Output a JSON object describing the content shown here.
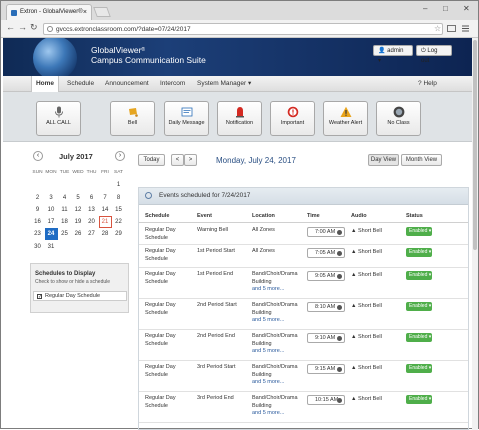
{
  "browser": {
    "tab_title": "Extron - GlobalViewer®",
    "url": "gvccs.extronclassroom.com/?date=07/24/2017"
  },
  "header": {
    "brand_line1": "GlobalViewer",
    "brand_reg": "®",
    "brand_line2": "Campus Communication Suite",
    "user_label": "admin",
    "logout_label": "Log out"
  },
  "menu": {
    "items": [
      "Home",
      "Schedule",
      "Announcement",
      "Intercom",
      "System Manager"
    ],
    "help": "Help"
  },
  "toolbar": {
    "buttons": [
      {
        "label": "ALL CALL",
        "icon": "microphone-icon"
      },
      {
        "label": "Bell",
        "icon": "bell-icon"
      },
      {
        "label": "Daily Message",
        "icon": "daily-message-icon"
      },
      {
        "label": "Notification",
        "icon": "siren-icon"
      },
      {
        "label": "Important",
        "icon": "alert-circle-icon"
      },
      {
        "label": "Weather Alert",
        "icon": "warning-triangle-icon"
      },
      {
        "label": "No Class",
        "icon": "no-class-icon"
      }
    ]
  },
  "calendar": {
    "title": "July 2017",
    "weekdays": [
      "SUN",
      "MON",
      "TUE",
      "WED",
      "THU",
      "FRI",
      "SAT"
    ],
    "weeks": [
      [
        "",
        "",
        "",
        "",
        "",
        "",
        "1"
      ],
      [
        "2",
        "3",
        "4",
        "5",
        "6",
        "7",
        "8"
      ],
      [
        "9",
        "10",
        "11",
        "12",
        "13",
        "14",
        "15"
      ],
      [
        "16",
        "17",
        "18",
        "19",
        "20",
        "21",
        "22"
      ],
      [
        "23",
        "24",
        "25",
        "26",
        "27",
        "28",
        "29"
      ],
      [
        "30",
        "31",
        "",
        "",
        "",
        "",
        ""
      ]
    ],
    "today": "24",
    "marked": "21"
  },
  "schedules": {
    "title": "Schedules to Display",
    "subtitle": "Check to show or hide a schedule",
    "item": "Regular Day Schedule"
  },
  "datebar": {
    "today": "Today",
    "prev": "<",
    "next": ">",
    "title": "Monday, July 24, 2017",
    "day_view": "Day View",
    "month_view": "Month View"
  },
  "events": {
    "header": "Events scheduled for 7/24/2017",
    "columns": [
      "Schedule",
      "Event",
      "Location",
      "Time",
      "Audio",
      "Status"
    ],
    "rows": [
      {
        "schedule": "Regular Day Schedule",
        "event": "Warning Bell",
        "location": "All Zones",
        "more": "",
        "time": "7:00 AM",
        "audio": "Short Bell",
        "status": "Enabled"
      },
      {
        "schedule": "Regular Day Schedule",
        "event": "1st Period Start",
        "location": "All Zones",
        "more": "",
        "time": "7:05 AM",
        "audio": "Short Bell",
        "status": "Enabled"
      },
      {
        "schedule": "Regular Day Schedule",
        "event": "1st Period End",
        "location": "Band/Choir/Drama Building",
        "more": "and 5 more...",
        "time": "9:05 AM",
        "audio": "Short Bell",
        "status": "Enabled"
      },
      {
        "schedule": "Regular Day Schedule",
        "event": "2nd Period Start",
        "location": "Band/Choir/Drama Building",
        "more": "and 5 more...",
        "time": "8:10 AM",
        "audio": "Short Bell",
        "status": "Enabled"
      },
      {
        "schedule": "Regular Day Schedule",
        "event": "2nd Period End",
        "location": "Band/Choir/Drama Building",
        "more": "and 5 more...",
        "time": "9:10 AM",
        "audio": "Short Bell",
        "status": "Enabled"
      },
      {
        "schedule": "Regular Day Schedule",
        "event": "3rd Period Start",
        "location": "Band/Choir/Drama Building",
        "more": "and 5 more...",
        "time": "9:15 AM",
        "audio": "Short Bell",
        "status": "Enabled"
      },
      {
        "schedule": "Regular Day Schedule",
        "event": "3rd Period End",
        "location": "Band/Choir/Drama Building",
        "more": "and 5 more...",
        "time": "10:15 AM",
        "audio": "Short Bell",
        "status": "Enabled"
      }
    ]
  }
}
